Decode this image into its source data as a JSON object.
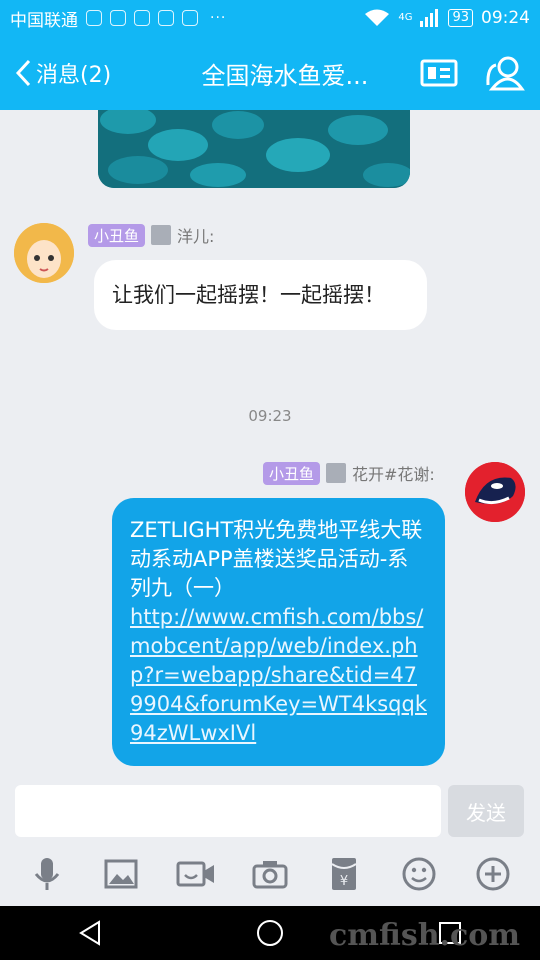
{
  "status": {
    "carrier": "中国联通",
    "more": "···",
    "network": "4G",
    "battery": "93",
    "time": "09:24"
  },
  "header": {
    "back_label": "消息(2)",
    "title": "全国海水鱼爱..."
  },
  "messages": {
    "m1": {
      "tag": "小丑鱼",
      "name": "洋儿:",
      "text": "让我们一起摇摆！一起摇摆！"
    },
    "time": "09:23",
    "m2": {
      "tag": "小丑鱼",
      "name": "花开#花谢:",
      "text": "ZETLIGHT积光免费地平线大联动系动APP盖楼送奖品活动-系列九（一）",
      "link": "http://www.cmfish.com/bbs/mobcent/app/web/index.php?r=webapp/share&tid=479904&forumKey=WT4ksqqk94zWLwxIVl"
    }
  },
  "composer": {
    "placeholder": "",
    "send_label": "发送"
  },
  "watermark": "cmfish.com",
  "colors": {
    "accent": "#12b7f5",
    "bubble_out": "#12a4e8",
    "tag": "#b49ae8"
  }
}
